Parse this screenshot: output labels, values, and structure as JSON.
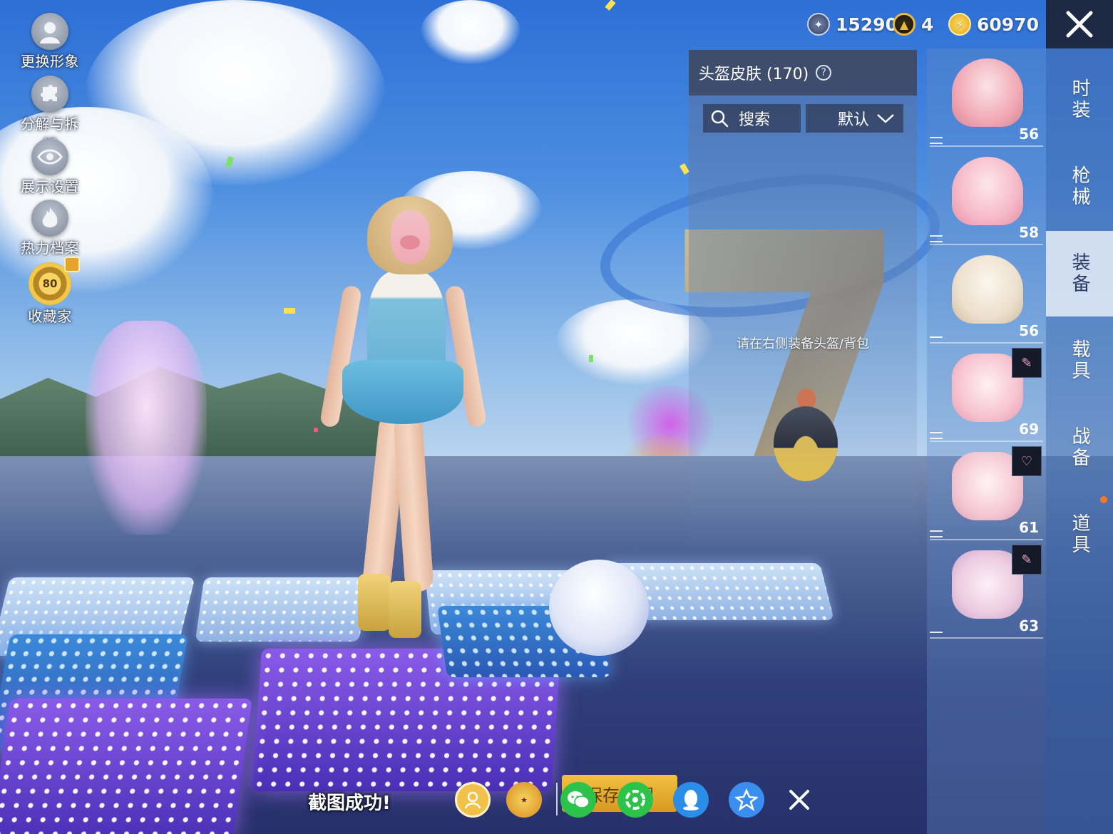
{
  "currency": {
    "silver": "15290",
    "gold": "4",
    "coupon": "60970"
  },
  "left_menu": [
    {
      "label": "更换形象",
      "icon": "avatar-silhouette-icon"
    },
    {
      "label": "分解与拆解",
      "icon": "puzzle-icon"
    },
    {
      "label": "展示设置",
      "icon": "eye-icon"
    },
    {
      "label": "热力档案",
      "icon": "flame-icon"
    },
    {
      "label": "收藏家",
      "icon": "collector-badge-icon",
      "badge": "80"
    }
  ],
  "skin_panel": {
    "title": "头盔皮肤 (170)",
    "search_label": "搜索",
    "sort_label": "默认",
    "hint": "请在右侧装备头盔/背包"
  },
  "items": [
    {
      "name": "pink-cat-helmet",
      "count": "56"
    },
    {
      "name": "pink-witch-hat-helmet",
      "count": "58"
    },
    {
      "name": "cream-bunny-helmet",
      "count": "56"
    },
    {
      "name": "pink-cat-backpack",
      "count": "69"
    },
    {
      "name": "pink-bunny-backpack",
      "count": "61"
    },
    {
      "name": "bunny-plush-backpack",
      "count": "63"
    }
  ],
  "categories": [
    {
      "label": "时装",
      "active": false
    },
    {
      "label": "枪械",
      "active": false
    },
    {
      "label": "装备",
      "active": true
    },
    {
      "label": "载具",
      "active": false
    },
    {
      "label": "战备",
      "active": false
    },
    {
      "label": "道具",
      "active": false
    }
  ],
  "bottom": {
    "screenshot_toast": "截图成功!",
    "save_label": "保存截图",
    "share_targets": [
      "gift-share-icon",
      "game-logo-icon",
      "wechat-icon",
      "moments-icon",
      "qq-icon",
      "qzone-icon",
      "close-icon"
    ]
  },
  "colors": {
    "active_tab_bg": "#dce6f5",
    "save_button": "#f2c043",
    "wechat_green": "#2dc24a",
    "qq_blue": "#2b8de8"
  }
}
